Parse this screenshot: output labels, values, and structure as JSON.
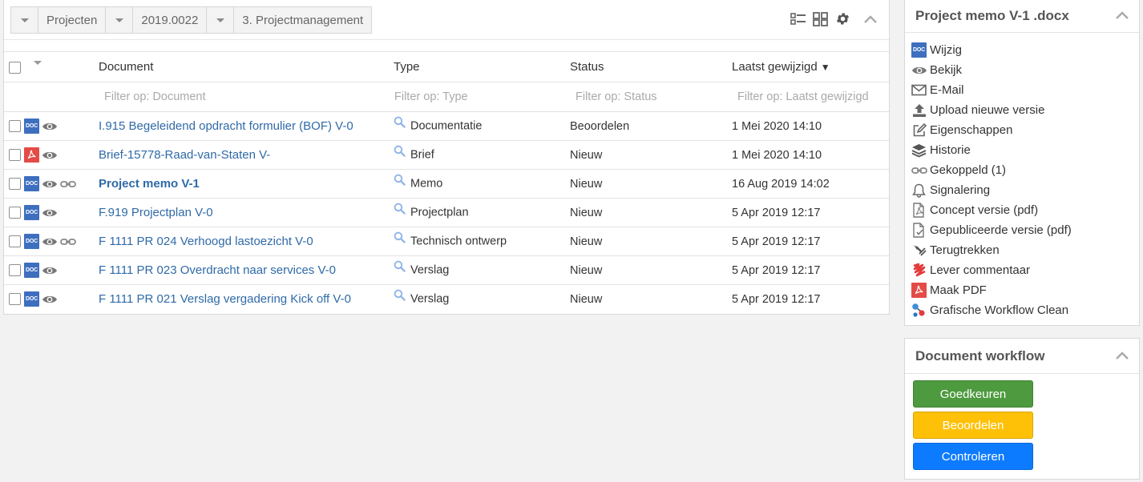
{
  "breadcrumb": [
    {
      "label": "Projecten"
    },
    {
      "label": "2019.0022"
    },
    {
      "label": "3. Projectmanagement"
    }
  ],
  "table": {
    "columns": {
      "document": "Document",
      "type": "Type",
      "status": "Status",
      "modified": "Laatst gewijzigd",
      "sort_indicator": "▼"
    },
    "filters": {
      "document": "Filter op: Document",
      "type": "Filter op: Type",
      "status": "Filter op: Status",
      "modified": "Filter op: Laatst gewijzigd"
    },
    "rows": [
      {
        "icon": "doc",
        "linked": false,
        "document": "I.915 Begeleidend opdracht formulier (BOF) V-0",
        "type": "Documentatie",
        "status": "Beoordelen",
        "modified": "1 Mei 2020 14:10",
        "bold": false
      },
      {
        "icon": "pdf",
        "linked": false,
        "document": "Brief-15778-Raad-van-Staten V-",
        "type": "Brief",
        "status": "Nieuw",
        "modified": "1 Mei 2020 14:10",
        "bold": false
      },
      {
        "icon": "doc",
        "linked": true,
        "document": "Project memo V-1",
        "type": "Memo",
        "status": "Nieuw",
        "modified": "16 Aug 2019 14:02",
        "bold": true
      },
      {
        "icon": "doc",
        "linked": false,
        "document": "F.919 Projectplan V-0",
        "type": "Projectplan",
        "status": "Nieuw",
        "modified": "5 Apr 2019 12:17",
        "bold": false
      },
      {
        "icon": "doc",
        "linked": true,
        "document": "F 1111 PR 024 Verhoogd lastoezicht V-0",
        "type": "Technisch ontwerp",
        "status": "Nieuw",
        "modified": "5 Apr 2019 12:17",
        "bold": false
      },
      {
        "icon": "doc",
        "linked": false,
        "document": "F 1111 PR 023 Overdracht naar services V-0",
        "type": "Verslag",
        "status": "Nieuw",
        "modified": "5 Apr 2019 12:17",
        "bold": false
      },
      {
        "icon": "doc",
        "linked": false,
        "document": "F 1111 PR 021 Verslag vergadering Kick off V-0",
        "type": "Verslag",
        "status": "Nieuw",
        "modified": "5 Apr 2019 12:17",
        "bold": false
      }
    ]
  },
  "icons": {
    "doc_badge": "DOC"
  },
  "memo_panel": {
    "title": "Project memo V-1 .docx",
    "actions": [
      {
        "label": "Wijzig",
        "icon": "doc-icon"
      },
      {
        "label": "Bekijk",
        "icon": "eye-icon"
      },
      {
        "label": "E-Mail",
        "icon": "envelope-icon"
      },
      {
        "label": "Upload nieuwe versie",
        "icon": "upload-icon"
      },
      {
        "label": "Eigenschappen",
        "icon": "edit-icon"
      },
      {
        "label": "Historie",
        "icon": "layers-icon"
      },
      {
        "label": "Gekoppeld (1)",
        "icon": "link-icon"
      },
      {
        "label": "Signalering",
        "icon": "bell-icon"
      },
      {
        "label": "Concept versie (pdf)",
        "icon": "file-pdf-outline-icon"
      },
      {
        "label": "Gepubliceerde versie (pdf)",
        "icon": "file-check-icon"
      },
      {
        "label": "Terugtrekken",
        "icon": "retract-icon"
      },
      {
        "label": "Lever commentaar",
        "icon": "comment-scribble-icon"
      },
      {
        "label": "Maak PDF",
        "icon": "pdf-icon"
      },
      {
        "label": "Grafische Workflow Clean",
        "icon": "workflow-icon"
      }
    ]
  },
  "workflow_panel": {
    "title": "Document workflow",
    "buttons": [
      {
        "label": "Goedkeuren",
        "color": "#4e9a3f"
      },
      {
        "label": "Beoordelen",
        "color": "#ffc107"
      },
      {
        "label": "Controleren",
        "color": "#0d7bff"
      }
    ]
  }
}
